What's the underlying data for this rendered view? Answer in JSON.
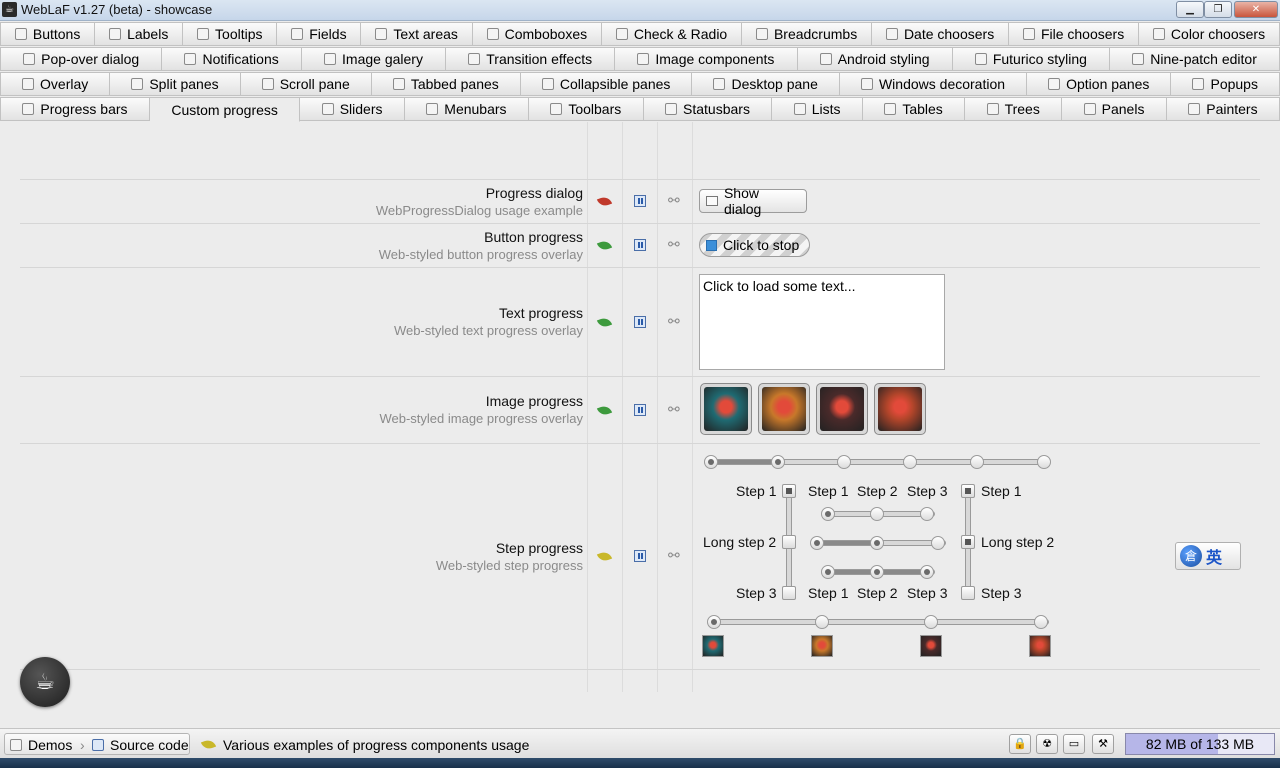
{
  "window": {
    "title": "WebLaF v1.27 (beta) - showcase",
    "controls": [
      "minimize",
      "maximize",
      "close"
    ]
  },
  "tabs": {
    "row1": [
      {
        "label": "Buttons",
        "icon": "button-icon"
      },
      {
        "label": "Labels",
        "icon": "label-icon"
      },
      {
        "label": "Tooltips",
        "icon": "tooltip-icon"
      },
      {
        "label": "Fields",
        "icon": "field-icon"
      },
      {
        "label": "Text areas",
        "icon": "textarea-icon"
      },
      {
        "label": "Comboboxes",
        "icon": "combobox-icon"
      },
      {
        "label": "Check & Radio",
        "icon": "checkbox-icon"
      },
      {
        "label": "Breadcrumbs",
        "icon": "breadcrumb-icon"
      },
      {
        "label": "Date choosers",
        "icon": "calendar-icon"
      },
      {
        "label": "File choosers",
        "icon": "file-icon"
      },
      {
        "label": "Color choosers",
        "icon": "palette-icon"
      }
    ],
    "row2": [
      {
        "label": "Pop-over dialog",
        "icon": "popover-icon"
      },
      {
        "label": "Notifications",
        "icon": "info-icon"
      },
      {
        "label": "Image galery",
        "icon": "image-icon"
      },
      {
        "label": "Transition effects",
        "icon": "transition-icon"
      },
      {
        "label": "Image components",
        "icon": "image-icon"
      },
      {
        "label": "Android styling",
        "icon": "android-icon"
      },
      {
        "label": "Futurico styling",
        "icon": "brush-icon"
      },
      {
        "label": "Nine-patch editor",
        "icon": "ninepatch-icon"
      }
    ],
    "row3": [
      {
        "label": "Overlay",
        "icon": "overlay-icon"
      },
      {
        "label": "Split panes",
        "icon": "splitpane-icon"
      },
      {
        "label": "Scroll pane",
        "icon": "scrollpane-icon"
      },
      {
        "label": "Tabbed panes",
        "icon": "tab-icon"
      },
      {
        "label": "Collapsible panes",
        "icon": "collapsible-icon"
      },
      {
        "label": "Desktop pane",
        "icon": "desktop-icon"
      },
      {
        "label": "Windows decoration",
        "icon": "window-icon"
      },
      {
        "label": "Option panes",
        "icon": "optionpane-icon"
      },
      {
        "label": "Popups",
        "icon": "popup-icon"
      }
    ],
    "row4": [
      {
        "label": "Progress bars",
        "icon": "progressbar-icon"
      },
      {
        "label": "Custom progress",
        "icon": "",
        "selected": true
      },
      {
        "label": "Sliders",
        "icon": "slider-icon"
      },
      {
        "label": "Menubars",
        "icon": "menubar-icon"
      },
      {
        "label": "Toolbars",
        "icon": "toolbar-icon"
      },
      {
        "label": "Statusbars",
        "icon": "statusbar-icon"
      },
      {
        "label": "Lists",
        "icon": "list-icon"
      },
      {
        "label": "Tables",
        "icon": "table-icon"
      },
      {
        "label": "Trees",
        "icon": "tree-icon"
      },
      {
        "label": "Panels",
        "icon": "panel-icon"
      },
      {
        "label": "Painters",
        "icon": "painter-icon"
      }
    ]
  },
  "examples": [
    {
      "title": "Progress dialog",
      "desc": "WebProgressDialog usage example",
      "leaf": "#c0392b",
      "button": "Show dialog"
    },
    {
      "title": "Button progress",
      "desc": "Web-styled button progress overlay",
      "leaf": "#3d9a3d",
      "button": "Click to stop"
    },
    {
      "title": "Text progress",
      "desc": "Web-styled text progress overlay",
      "leaf": "#3d9a3d",
      "textarea": "Click to load some text..."
    },
    {
      "title": "Image progress",
      "desc": "Web-styled image progress overlay",
      "leaf": "#3d9a3d"
    },
    {
      "title": "Step progress",
      "desc": "Web-styled step progress",
      "leaf": "#c9b82a"
    }
  ],
  "step_progress": {
    "top_slider_steps": 6,
    "top_slider_selected": 1,
    "labels_left": [
      "Step 1",
      "Long step 2",
      "Step 3"
    ],
    "labels_mid_top": [
      "Step 1",
      "Step 2",
      "Step 3"
    ],
    "labels_mid_bottom": [
      "Step 1",
      "Step 2",
      "Step 3"
    ],
    "labels_right": [
      "Step 1",
      "Long step 2",
      "Step 3"
    ],
    "bottom_slider_steps": 4
  },
  "colors": {
    "images": [
      "#1f6b73",
      "#c8782a",
      "#4a2a2a",
      "#b2452a"
    ]
  },
  "ime": {
    "glyph1": "倉",
    "glyph2": "英"
  },
  "status": {
    "crumb_demos": "Demos",
    "crumb_source": "Source code",
    "message": "Various examples of progress components usage",
    "memory": "82 MB of 133 MB",
    "memory_used_fraction": 0.62
  }
}
